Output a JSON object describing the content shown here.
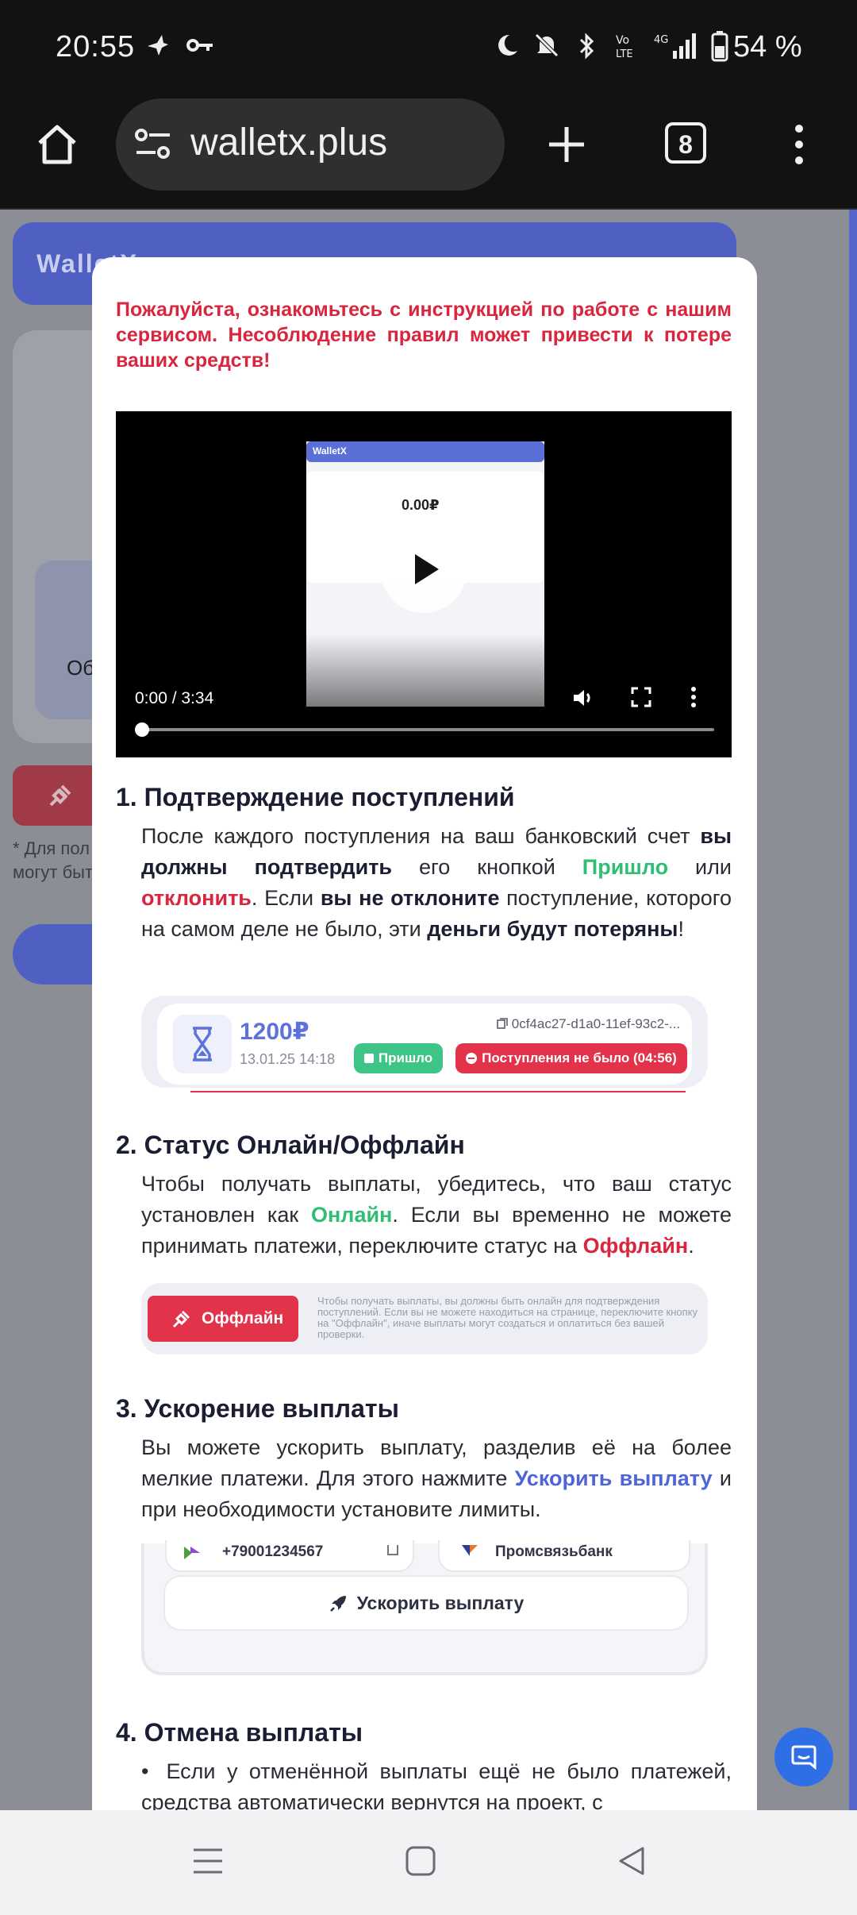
{
  "status_bar": {
    "time": "20:55",
    "battery": "54 %"
  },
  "browser": {
    "url": "walletx.plus",
    "tab_count": "8"
  },
  "background": {
    "logo": "WalletX",
    "partial_label": "Об",
    "note_line1": "* Для пол",
    "note_line2": "могут быт"
  },
  "modal": {
    "warning": "Пожалуйста, ознакомьтесь с инструкцией по работе с нашим сервисом. Несоблюдение правил может привести к потере ваших средств!",
    "video": {
      "timecode": "0:00 / 3:34",
      "preview_logo": "WalletX",
      "preview_balance": "0.00₽"
    },
    "s1": {
      "title": "1. Подтверждение поступлений",
      "t1": "После каждого поступления на ваш банковский счет ",
      "b1": "вы должны подтвердить",
      "t2": " его кнопкой ",
      "g1": "Пришло",
      "t3": " или ",
      "r1": "отклонить",
      "t4": ". Если ",
      "b2": "вы не отклоните",
      "t5": " поступление, которого на самом деле не было, эти ",
      "b3": "деньги будут потеряны",
      "t6": "!",
      "example": {
        "amount": "1200₽",
        "date": "13.01.25 14:18",
        "hash": "0cf4ac27-d1a0-11ef-93c2-...",
        "arrived_label": "Пришло",
        "decline_label": "Поступления не было (04:56)"
      }
    },
    "s2": {
      "title": "2. Статус Онлайн/Оффлайн",
      "t1": "Чтобы получать выплаты, убедитесь, что ваш статус установлен как ",
      "g1": "Онлайн",
      "t2": ". Если вы временно не можете принимать платежи, переключите статус на ",
      "r1": "Оффлайн",
      "t3": ".",
      "example": {
        "button_label": "Оффлайн",
        "note": "Чтобы получать выплаты, вы должны быть онлайн для подтверждения поступлений. Если вы не можете находиться на странице, переключите кнопку на \"Оффлайн\", иначе выплаты могут создаться и оплатиться без вашей проверки."
      }
    },
    "s3": {
      "title": "3. Ускорение выплаты",
      "t1": "Вы можете ускорить выплату, разделив её на более мелкие платежи. Для этого нажмите ",
      "l1": "Ускорить выплату",
      "t2": " и при необходимости установите лимиты.",
      "example": {
        "phone": "+79001234567",
        "bank": "Промсвязьбанк",
        "button_label": "Ускорить выплату"
      }
    },
    "s4": {
      "title": "4. Отмена выплаты",
      "bullet": "Если у отменённой выплаты ещё не было платежей, средства автоматически вернутся на проект, с"
    }
  },
  "colors": {
    "accent": "#4f64d8",
    "danger": "#d7263d",
    "success": "#2fbf74"
  }
}
